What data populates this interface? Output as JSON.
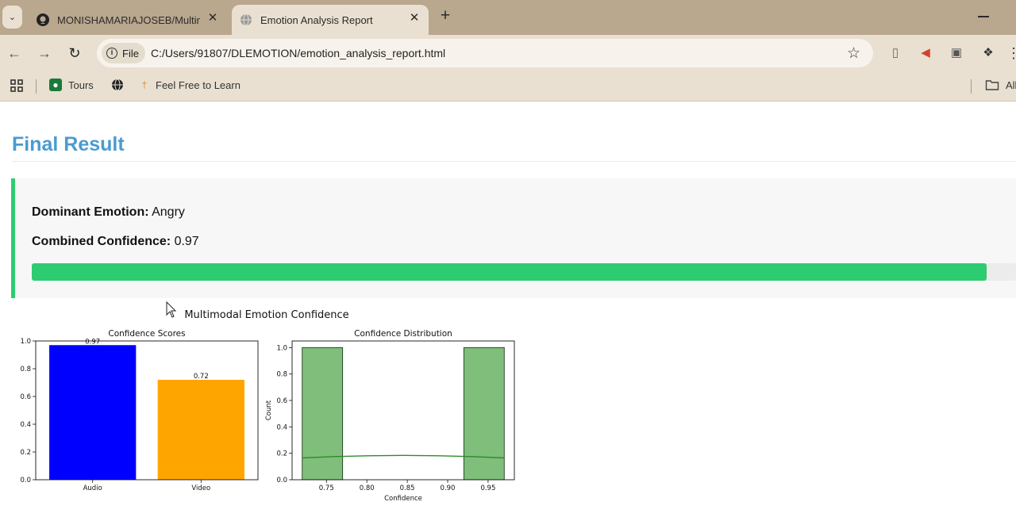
{
  "browser": {
    "tabs": [
      {
        "title": "MONISHAMARIAJOSEB/Multim",
        "icon": "github-icon",
        "active": false
      },
      {
        "title": "Emotion Analysis Report",
        "icon": "globe-icon",
        "active": true
      }
    ],
    "address": {
      "scheme_label": "File",
      "url": "C:/Users/91807/DLEMOTION/emotion_analysis_report.html"
    },
    "bookmarks": [
      {
        "label": "Tours",
        "icon": "tours-icon"
      },
      {
        "label": "",
        "icon": "globe-icon"
      },
      {
        "label": "Feel Free to Learn",
        "icon": "pin-icon"
      }
    ],
    "bookmarks_overflow": "All"
  },
  "report": {
    "section_title": "Final Result",
    "dominant_label": "Dominant Emotion:",
    "dominant_value": "Angry",
    "confidence_label": "Combined Confidence:",
    "confidence_value": "0.97",
    "confidence_fraction": 0.97,
    "accent_color": "#2ecc71",
    "title_color": "#4a9bd0"
  },
  "figure": {
    "suptitle": "Multimodal Emotion Confidence"
  },
  "chart_data": [
    {
      "type": "bar",
      "title": "Confidence Scores",
      "categories": [
        "Audio",
        "Video"
      ],
      "values": [
        0.97,
        0.72
      ],
      "value_labels": [
        "0.97",
        "0.72"
      ],
      "colors": [
        "#0000ff",
        "#ffa500"
      ],
      "ylim": [
        0,
        1.0
      ],
      "yticks": [
        "0.0",
        "0.2",
        "0.4",
        "0.6",
        "0.8",
        "1.0"
      ],
      "xlabel": "",
      "ylabel": "",
      "grid": false
    },
    {
      "type": "bar",
      "title": "Confidence Distribution",
      "xlabel": "Confidence",
      "ylabel": "Count",
      "bins": [
        {
          "x0": 0.72,
          "x1": 0.77,
          "count": 1.0
        },
        {
          "x0": 0.92,
          "x1": 0.97,
          "count": 1.0
        }
      ],
      "kde": [
        [
          0.72,
          0.165
        ],
        [
          0.76,
          0.175
        ],
        [
          0.8,
          0.181
        ],
        [
          0.845,
          0.184
        ],
        [
          0.89,
          0.181
        ],
        [
          0.93,
          0.175
        ],
        [
          0.97,
          0.165
        ]
      ],
      "xlim": [
        0.72,
        0.97
      ],
      "ylim": [
        0,
        1.05
      ],
      "xticks": [
        "0.75",
        "0.80",
        "0.85",
        "0.90",
        "0.95"
      ],
      "yticks": [
        "0.0",
        "0.2",
        "0.4",
        "0.6",
        "0.8",
        "1.0"
      ],
      "bar_color": "#7fbf7b",
      "kde_color": "#2e8b2e",
      "grid": false
    }
  ]
}
